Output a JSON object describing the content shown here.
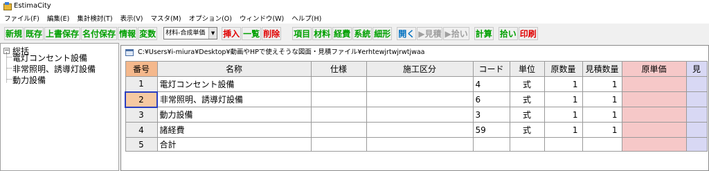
{
  "window": {
    "title": "EstimaCity"
  },
  "menu": [
    "ファイル(F)",
    "編集(E)",
    "集計検討(T)",
    "表示(V)",
    "マスタ(M)",
    "オプション(O)",
    "ウィンドウ(W)",
    "ヘルプ(H)"
  ],
  "toolbar": {
    "new": "新規",
    "existing": "既存",
    "overwrite_save": "上書保存",
    "named_save": "名付保存",
    "info": "情報",
    "variables": "変数",
    "select_value": "材料-合成単価",
    "insert": "挿入",
    "list": "一覧",
    "delete": "削除",
    "item": "項目",
    "material": "材料",
    "expense": "経費",
    "system": "系統",
    "breakdown": "細形",
    "open": "開く",
    "estimate": "▶見積",
    "pickup": "▶拾い",
    "calc": "計算",
    "pickup2": "拾い",
    "print": "印刷"
  },
  "tree": {
    "expander": "−",
    "root": "総括",
    "children": [
      "電灯コンセント設備",
      "非常照明、誘導灯設備",
      "動力設備"
    ]
  },
  "document": {
    "path": "C:¥Users¥i-miura¥Desktop¥動画やHPで使えそうな図面・見積ファイル¥erhtewjrtwjrwtjwaa"
  },
  "table": {
    "headers": [
      "番号",
      "名称",
      "仕様",
      "施工区分",
      "コード",
      "単位",
      "原数量",
      "見積数量",
      "原単価",
      "見"
    ],
    "rows": [
      {
        "no": "1",
        "name": "電灯コンセント設備",
        "spec": "",
        "division": "",
        "code": "4",
        "unit": "式",
        "orig_qty": "1",
        "est_qty": "1"
      },
      {
        "no": "2",
        "name": "非常照明、誘導灯設備",
        "spec": "",
        "division": "",
        "code": "6",
        "unit": "式",
        "orig_qty": "1",
        "est_qty": "1"
      },
      {
        "no": "3",
        "name": "動力設備",
        "spec": "",
        "division": "",
        "code": "3",
        "unit": "式",
        "orig_qty": "1",
        "est_qty": "1"
      },
      {
        "no": "4",
        "name": "諸経費",
        "spec": "",
        "division": "",
        "code": "59",
        "unit": "式",
        "orig_qty": "1",
        "est_qty": "1"
      },
      {
        "no": "5",
        "name": "合計",
        "spec": "",
        "division": "",
        "code": "",
        "unit": "",
        "orig_qty": "",
        "est_qty": ""
      }
    ]
  },
  "colors": {
    "header_num": "#f4b88c",
    "selected": "#f6c9a2",
    "unit_price": "#f6c8c8",
    "estimate_col": "#d8d8f4",
    "green": "#00a000",
    "red": "#e00000",
    "blue": "#0070c0"
  }
}
